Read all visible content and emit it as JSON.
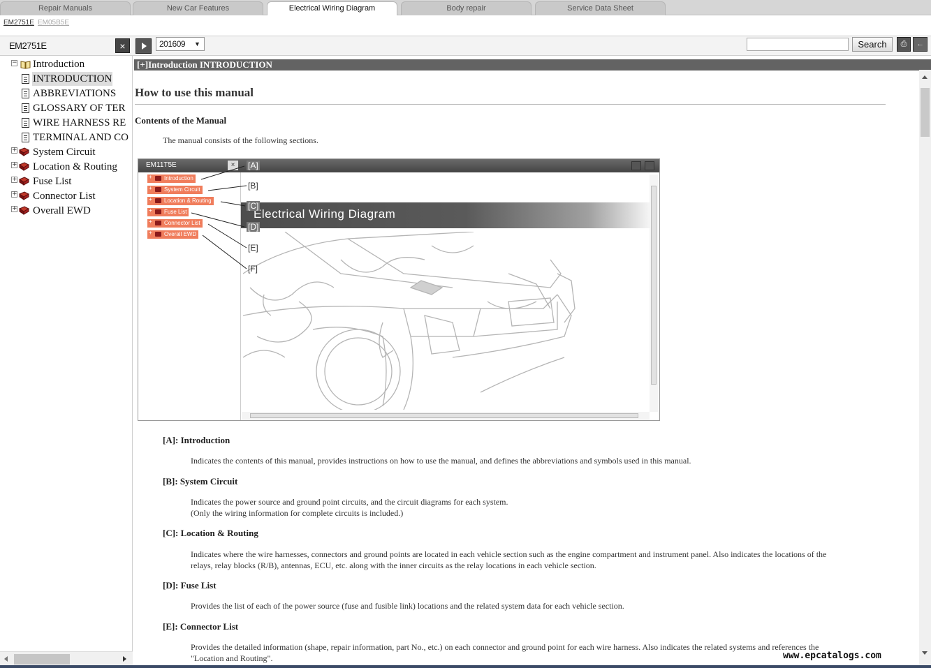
{
  "tabs": [
    {
      "label": "Repair Manuals"
    },
    {
      "label": "New Car Features"
    },
    {
      "label": "Electrical Wiring Diagram",
      "active": true
    },
    {
      "label": "Body repair"
    },
    {
      "label": "Service Data Sheet"
    }
  ],
  "doc_ids": [
    "EM2751E",
    "EM05B5E"
  ],
  "toolbar": {
    "doc_title": "EM2751E",
    "close_icon": "×",
    "version": "201609",
    "version_arrow": "▼",
    "search_placeholder": "",
    "search_label": "Search",
    "print_icon": "⎙",
    "back_icon": "←"
  },
  "tree": {
    "root": {
      "label": "Introduction",
      "toggle": "−"
    },
    "children": [
      {
        "label": "INTRODUCTION"
      },
      {
        "label": "ABBREVIATIONS"
      },
      {
        "label": "GLOSSARY OF TER"
      },
      {
        "label": "WIRE HARNESS RE"
      },
      {
        "label": "TERMINAL AND CO"
      }
    ],
    "sections": [
      {
        "label": "System Circuit",
        "toggle": "+"
      },
      {
        "label": "Location & Routing",
        "toggle": "+"
      },
      {
        "label": "Fuse List",
        "toggle": "+"
      },
      {
        "label": "Connector List",
        "toggle": "+"
      },
      {
        "label": "Overall EWD",
        "toggle": "+"
      }
    ]
  },
  "content": {
    "section_header": "[+]Introduction  INTRODUCTION",
    "heading": "How to use this manual",
    "contents_title": "Contents of the Manual",
    "intro_text": "The manual consists of the following sections.",
    "figure": {
      "title": "EM11T5E",
      "close": "×",
      "items": [
        "Introduction",
        "System Circuit",
        "Location & Routing",
        "Fuse List",
        "Connector List",
        "Overall EWD"
      ],
      "banner": "Electrical Wiring Diagram",
      "callouts": [
        "[A]",
        "[B]",
        "[C]",
        "[D]",
        "[E]",
        "[F]"
      ]
    },
    "items": [
      {
        "head": "[A]: Introduction",
        "body": [
          "Indicates the contents of this manual, provides instructions on how to use the manual, and defines the abbreviations and symbols used in this manual."
        ]
      },
      {
        "head": "[B]: System Circuit",
        "body": [
          "Indicates the power source and ground point circuits, and the circuit diagrams for each system.",
          "(Only the wiring information for complete circuits is included.)"
        ]
      },
      {
        "head": "[C]: Location & Routing",
        "body": [
          "Indicates where the wire harnesses, connectors and ground points are located in each vehicle section such as the engine compartment and instrument panel. Also indicates the locations of the",
          "relays, relay blocks (R/B), antennas, ECU, etc. along with the inner circuits as the relay locations in each vehicle section."
        ]
      },
      {
        "head": "[D]: Fuse List",
        "body": [
          "Provides the list of each of the power source (fuse and fusible link) locations and the related system data for each vehicle section."
        ]
      },
      {
        "head": "[E]: Connector List",
        "body": [
          "Provides the detailed information (shape, repair information, part No., etc.) on each connector and ground point for each wire harness. Also indicates the related systems and references the",
          "\"Location and Routing\"."
        ]
      }
    ]
  },
  "watermark": "www.epcatalogs.com",
  "colors": {
    "accent": "#f07d5c",
    "header": "#636363",
    "book": "#8b1a1a"
  }
}
